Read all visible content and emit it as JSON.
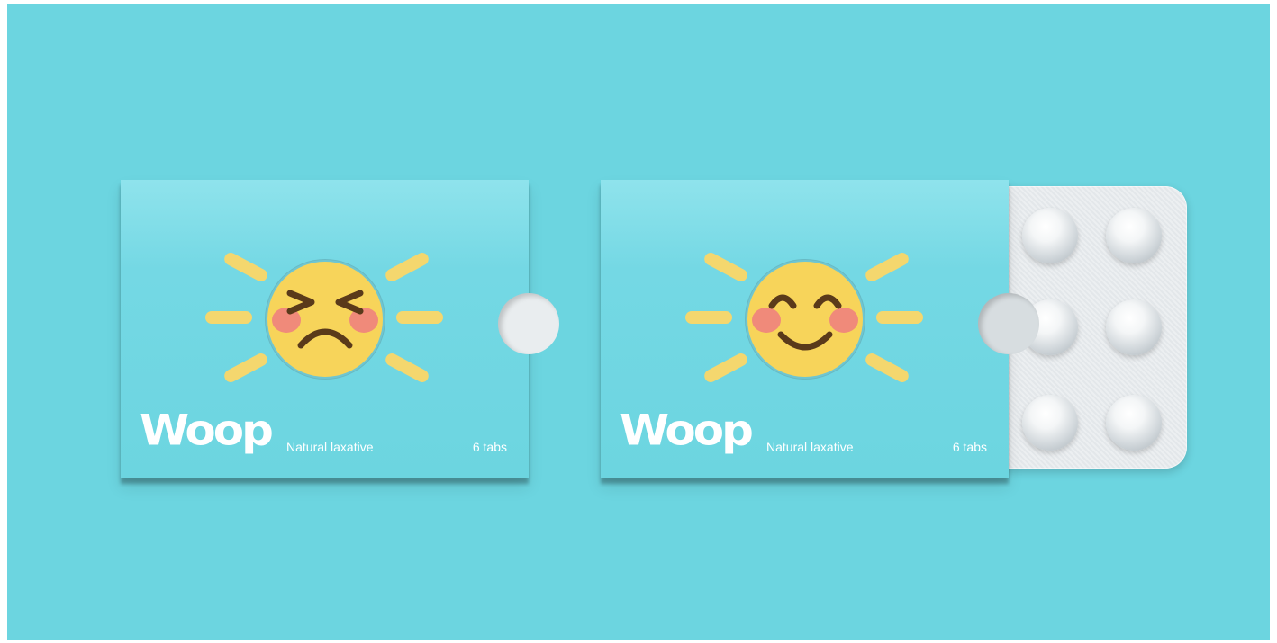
{
  "left_pack": {
    "brand": "Woop",
    "tagline": "Natural laxative",
    "count": "6 tabs",
    "emoji": "grimacing-face-icon"
  },
  "right_pack": {
    "brand": "Woop",
    "tagline": "Natural laxative",
    "count": "6 tabs",
    "emoji": "smiling-face-icon",
    "blister_pills": 6
  },
  "colors": {
    "background": "#6cd5e0",
    "sleeve": "#74d8e4",
    "rays": "#f4d76e",
    "face": "#f7d45a",
    "cheeks": "#f08a7a",
    "features": "#5a3a1a"
  }
}
